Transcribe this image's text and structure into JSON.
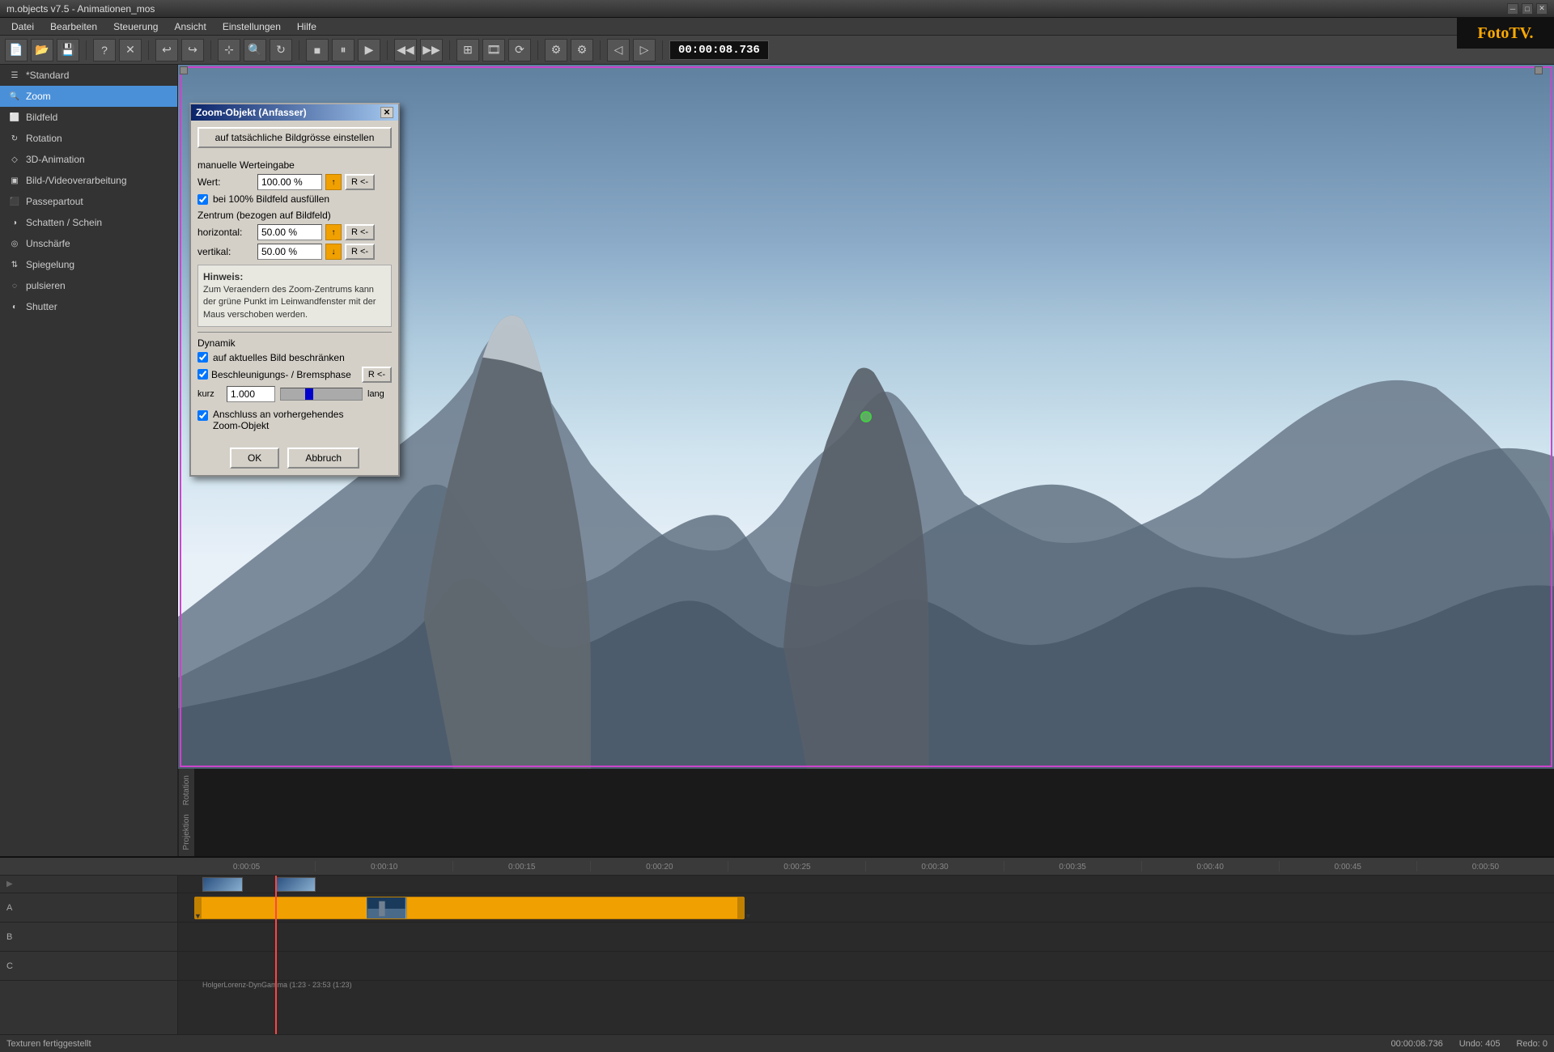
{
  "titlebar": {
    "title": "m.objects v7.5 - Animationen_mos",
    "minimize": "─",
    "maximize": "□",
    "close": "✕"
  },
  "menubar": {
    "items": [
      "Datei",
      "Bearbeiten",
      "Steuerung",
      "Ansicht",
      "Einstellungen",
      "Hilfe"
    ]
  },
  "toolbar": {
    "timecode": "00:00:08.736"
  },
  "sidebar": {
    "items": [
      {
        "id": "standard",
        "label": "*Standard",
        "icon": "☰"
      },
      {
        "id": "zoom",
        "label": "Zoom",
        "icon": "🔍",
        "selected": true
      },
      {
        "id": "bildfeld",
        "label": "Bildfeld",
        "icon": "⬜"
      },
      {
        "id": "rotation",
        "label": "Rotation",
        "icon": "↻"
      },
      {
        "id": "3d-animation",
        "label": "3D-Animation",
        "icon": "◇"
      },
      {
        "id": "bild-video",
        "label": "Bild-/Videoverarbeitung",
        "icon": "▣"
      },
      {
        "id": "passepartout",
        "label": "Passepartout",
        "icon": "⬛"
      },
      {
        "id": "schatten",
        "label": "Schatten / Schein",
        "icon": "◑"
      },
      {
        "id": "unschaerfe",
        "label": "Unschärfe",
        "icon": "◎"
      },
      {
        "id": "spiegelung",
        "label": "Spiegelung",
        "icon": "⇅"
      },
      {
        "id": "pulsieren",
        "label": "pulsieren",
        "icon": "◌"
      },
      {
        "id": "shutter",
        "label": "Shutter",
        "icon": "◐"
      }
    ]
  },
  "dialog": {
    "title": "Zoom-Objekt (Anfasser)",
    "btn_actual_size": "auf tatsächliche Bildgrösse einstellen",
    "section_manual": "manuelle Werteingabe",
    "wert_label": "Wert:",
    "wert_value": "100.00 %",
    "checkbox_fill": "bei 100% Bildfeld ausfüllen",
    "section_center": "Zentrum (bezogen auf Bildfeld)",
    "horizontal_label": "horizontal:",
    "horizontal_value": "50.00 %",
    "vertikal_label": "vertikal:",
    "vertikal_value": "50.00 %",
    "hint_title": "Hinweis:",
    "hint_text": "Zum Veraendern des Zoom-Zentrums kann der grüne Punkt im Leinwandfenster mit der Maus verschoben werden.",
    "section_dynamik": "Dynamik",
    "checkbox_restrict": "auf aktuelles Bild beschränken",
    "checkbox_accel": "Beschleunigungs- / Bremsphase",
    "kurz_label": "kurz",
    "lang_label": "lang",
    "accel_value": "1.000",
    "checkbox_connect": "Anschluss an vorhergehendes\nZoom-Objekt",
    "ok_label": "OK",
    "abbruch_label": "Abbruch"
  },
  "timeline": {
    "ruler_marks": [
      "0:00:15",
      "0:00:20",
      "0:00:25",
      "0:00:30",
      "0:00:35",
      "0:00:40",
      "0:00:45",
      "0:00:50"
    ],
    "clip_label": "HolgerLorenz-DynGamma (1:23 - 23:53 (1:23)",
    "track_labels": [
      "",
      "A",
      "B",
      "C"
    ]
  },
  "statusbar": {
    "left": "Texturen fertiggestellt",
    "timecode": "00:00:08.736",
    "undo": "Undo: 405",
    "redo": "Redo: 0"
  },
  "logo": {
    "text": "FotoTV.",
    "dot_color": "#ffaa00"
  }
}
